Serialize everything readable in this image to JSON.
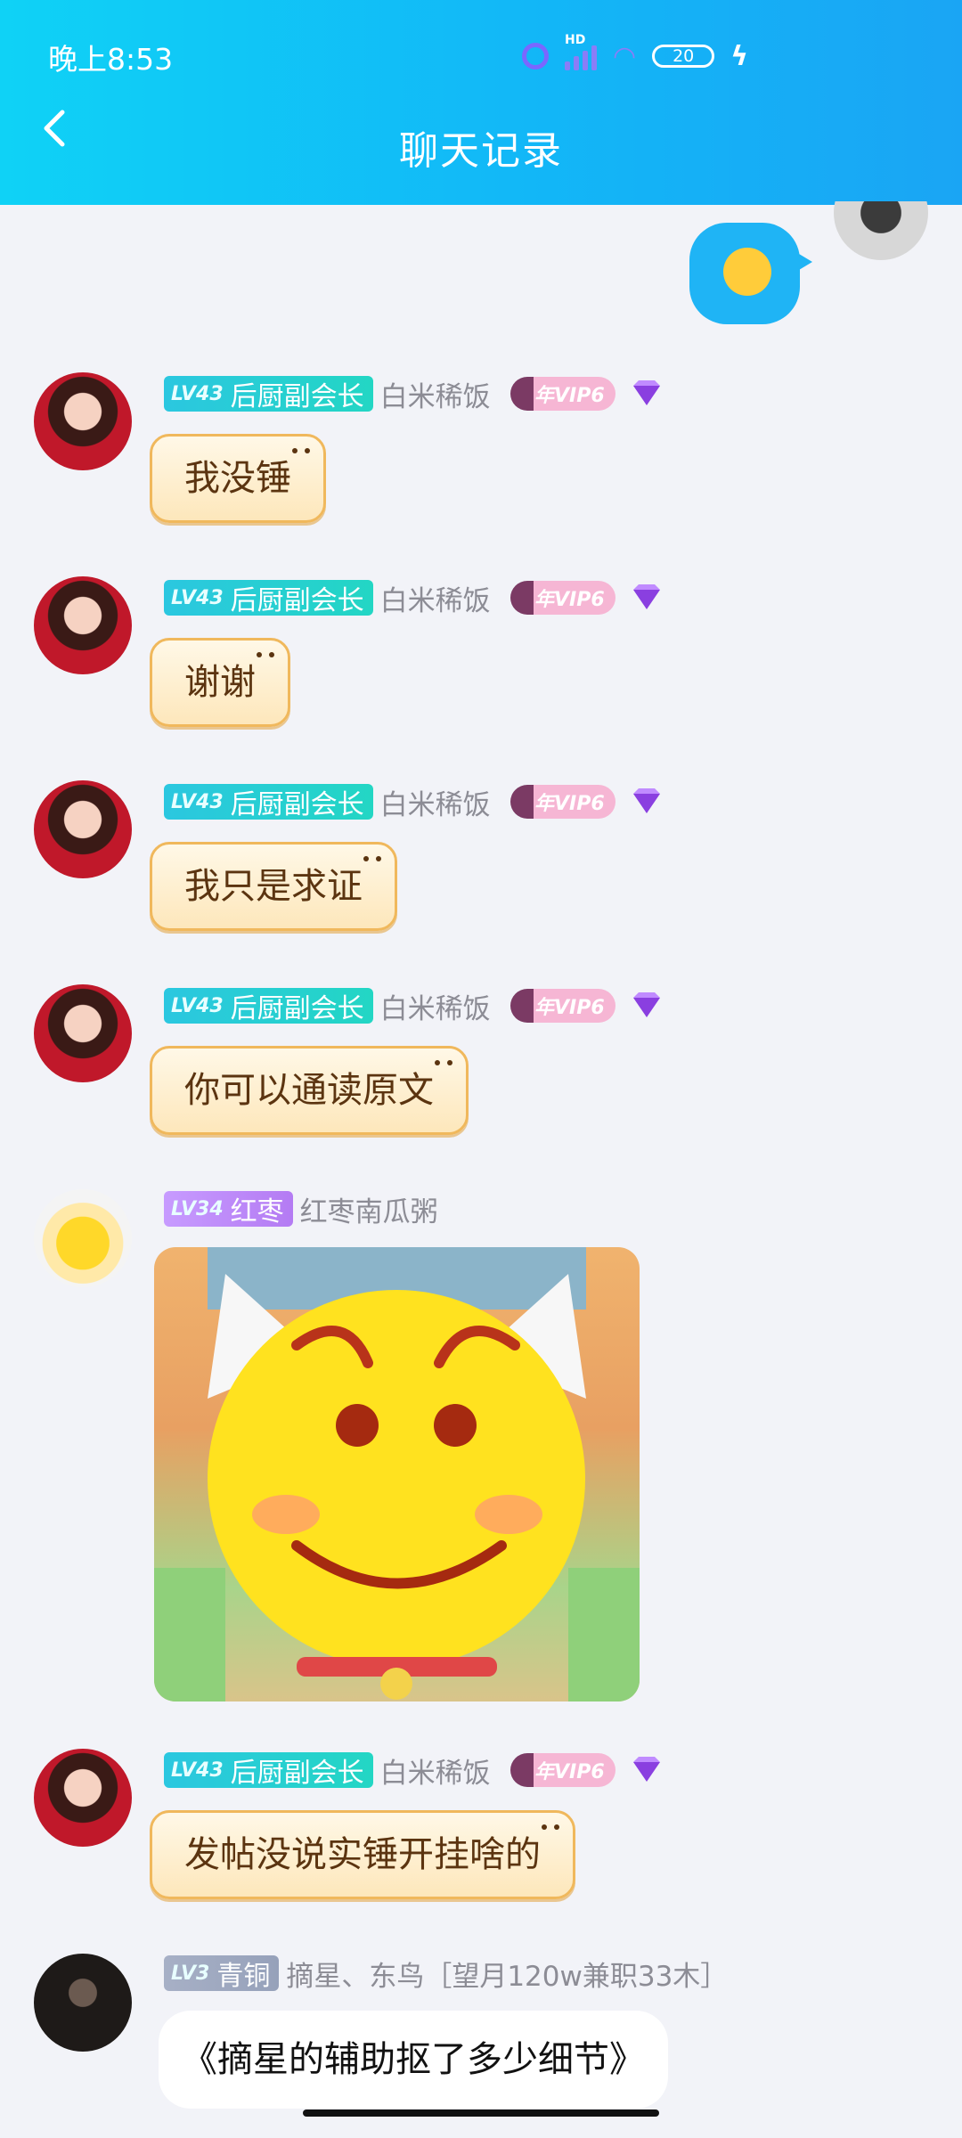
{
  "status_bar": {
    "time": "晚上8:53",
    "hd": "HD",
    "battery": "20"
  },
  "header": {
    "title": "聊天记录"
  },
  "colors": {
    "header_start": "#0fd2f6",
    "header_end": "#1aa5f4",
    "bubble_border": "#f0b85c",
    "sent_bubble": "#1fb4f5"
  },
  "messages": [
    {
      "level": "LV43",
      "title": "后厨副会长",
      "nickname": "白米稀饭",
      "vip": "年VIP6",
      "text": "我没锤"
    },
    {
      "level": "LV43",
      "title": "后厨副会长",
      "nickname": "白米稀饭",
      "vip": "年VIP6",
      "text": "谢谢"
    },
    {
      "level": "LV43",
      "title": "后厨副会长",
      "nickname": "白米稀饭",
      "vip": "年VIP6",
      "text": "我只是求证"
    },
    {
      "level": "LV43",
      "title": "后厨副会长",
      "nickname": "白米稀饭",
      "vip": "年VIP6",
      "text": "你可以通读原文"
    },
    {
      "level": "LV34",
      "title": "红枣",
      "nickname": "红枣南瓜粥",
      "sticker": "smiling-cat-sticker"
    },
    {
      "level": "LV43",
      "title": "后厨副会长",
      "nickname": "白米稀饭",
      "vip": "年VIP6",
      "text": "发帖没说实锤开挂啥的"
    },
    {
      "level": "LV3",
      "title": "青铜",
      "nickname": "摘星、东鸟［望月120w兼职33木］",
      "text": "《摘星的辅助抠了多少细节》"
    }
  ]
}
